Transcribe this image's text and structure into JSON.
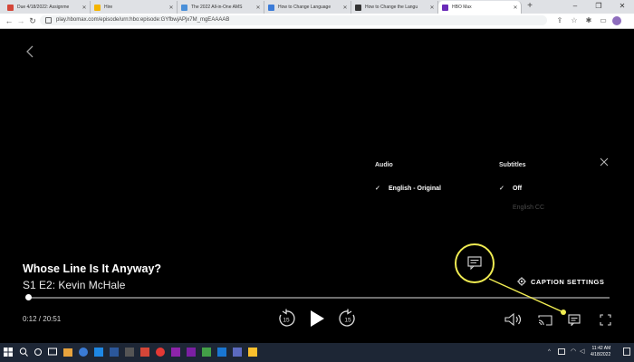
{
  "browser": {
    "tabs": [
      {
        "title": "Due 4/18/2022: Assignme",
        "favicon_color": "#d44638",
        "active": false
      },
      {
        "title": "Hire",
        "favicon_color": "#f4b400",
        "active": false
      },
      {
        "title": "The 2022 All-in-One AMS",
        "favicon_color": "#4a90d9",
        "active": false
      },
      {
        "title": "How to Change Language",
        "favicon_color": "#3b7bd8",
        "active": false
      },
      {
        "title": "How to Change the Langu",
        "favicon_color": "#333333",
        "active": false
      },
      {
        "title": "HBO Max",
        "favicon_color": "#6a2bb8",
        "active": true
      }
    ],
    "new_tab_symbol": "+",
    "window_controls": {
      "minimize": "–",
      "maximize": "❐",
      "close": "✕"
    },
    "nav": {
      "back": "←",
      "forward": "→",
      "reload": "↻"
    },
    "url": "play.hbomax.com/episode/urn:hbo:episode:GYfbwjAPjx7M_mgEAAAAB",
    "toolbar_icons": [
      "share-icon",
      "bookmark-star-icon",
      "extensions-icon",
      "profile-avatar"
    ]
  },
  "player": {
    "show_title": "Whose Line Is It Anyway?",
    "episode_title": "S1 E2: Kevin McHale",
    "time_display": "0:12 / 20:51",
    "progress_fraction": 0.003,
    "rewind_seconds": "15",
    "forward_seconds": "15",
    "panel": {
      "audio_heading": "Audio",
      "subtitles_heading": "Subtitles",
      "audio_options": [
        {
          "label": "English - Original",
          "selected": true
        }
      ],
      "subtitle_options": [
        {
          "label": "Off",
          "selected": true
        },
        {
          "label": "English CC",
          "selected": false
        }
      ],
      "caption_settings_label": "CAPTION SETTINGS"
    },
    "highlight_color": "#f0ec52"
  },
  "taskbar": {
    "time": "11:42 AM",
    "date": "4/18/2022",
    "app_colors": [
      "#3a7bd5",
      "#d44638",
      "#1e88e5",
      "#e53935",
      "#8e24aa",
      "#43a047",
      "#fbc02d",
      "#5c6bc0"
    ]
  }
}
